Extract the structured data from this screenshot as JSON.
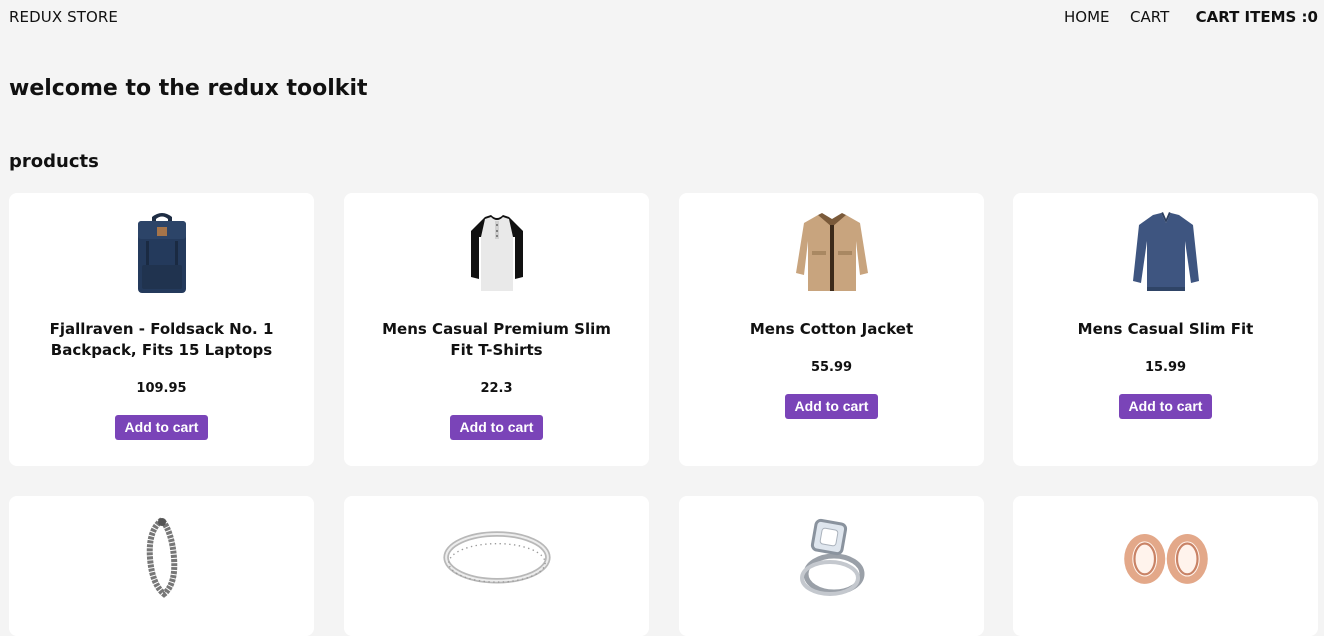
{
  "header": {
    "brand": "REDUX STORE",
    "nav": {
      "home": "HOME",
      "cart": "CART"
    },
    "cart_items": "CART ITEMS :0"
  },
  "main": {
    "heading": "welcome to the redux toolkit",
    "section_title": "products"
  },
  "products": [
    {
      "title": "Fjallraven - Foldsack No. 1 Backpack, Fits 15 Laptops",
      "price": "109.95",
      "button": "Add to cart",
      "icon": "backpack-icon"
    },
    {
      "title": "Mens Casual Premium Slim Fit T-Shirts",
      "price": "22.3",
      "button": "Add to cart",
      "icon": "tshirt-icon"
    },
    {
      "title": "Mens Cotton Jacket",
      "price": "55.99",
      "button": "Add to cart",
      "icon": "jacket-icon"
    },
    {
      "title": "Mens Casual Slim Fit",
      "price": "15.99",
      "button": "Add to cart",
      "icon": "sweater-icon"
    },
    {
      "icon": "bracelet-icon"
    },
    {
      "icon": "ring-icon"
    },
    {
      "icon": "diamond-ring-icon"
    },
    {
      "icon": "earrings-icon"
    }
  ],
  "colors": {
    "accent": "#7a44b8",
    "background": "#f4f4f4",
    "card": "#ffffff"
  }
}
